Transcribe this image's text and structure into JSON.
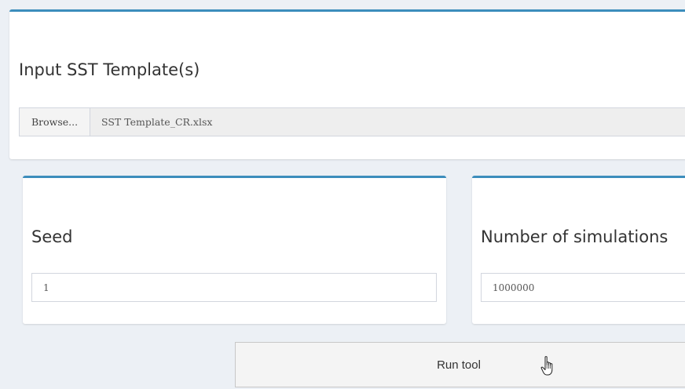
{
  "file_input": {
    "title": "Input SST Template(s)",
    "browse_label": "Browse...",
    "file_name": "SST Template_CR.xlsx"
  },
  "seed": {
    "title": "Seed",
    "value": "1"
  },
  "simulations": {
    "title": "Number of simulations",
    "value": "1000000"
  },
  "run": {
    "label": "Run tool"
  },
  "cursor": {
    "icon": "hand-pointer-icon"
  },
  "colors": {
    "background": "#ecf0f5",
    "box_accent": "#3c8dbc",
    "panel": "#ffffff",
    "button": "#f4f4f4"
  }
}
